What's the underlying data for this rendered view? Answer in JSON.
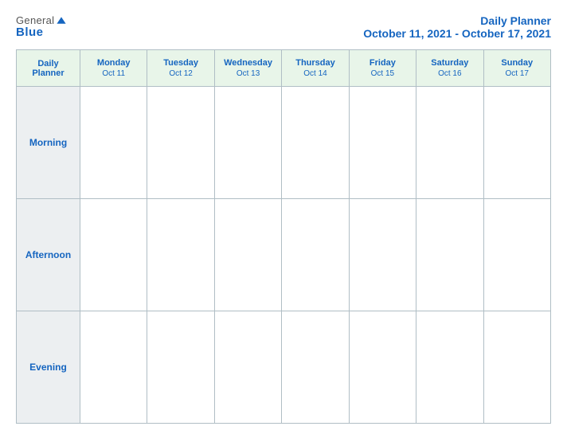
{
  "header": {
    "logo_general": "General",
    "logo_blue": "Blue",
    "title": "Daily Planner",
    "date_range": "October 11, 2021 - October 17, 2021"
  },
  "table": {
    "header_label": "Daily\nPlanner",
    "days": [
      {
        "name": "Monday",
        "date": "Oct 11"
      },
      {
        "name": "Tuesday",
        "date": "Oct 12"
      },
      {
        "name": "Wednesday",
        "date": "Oct 13"
      },
      {
        "name": "Thursday",
        "date": "Oct 14"
      },
      {
        "name": "Friday",
        "date": "Oct 15"
      },
      {
        "name": "Saturday",
        "date": "Oct 16"
      },
      {
        "name": "Sunday",
        "date": "Oct 17"
      }
    ],
    "rows": [
      {
        "label": "Morning"
      },
      {
        "label": "Afternoon"
      },
      {
        "label": "Evening"
      }
    ]
  }
}
